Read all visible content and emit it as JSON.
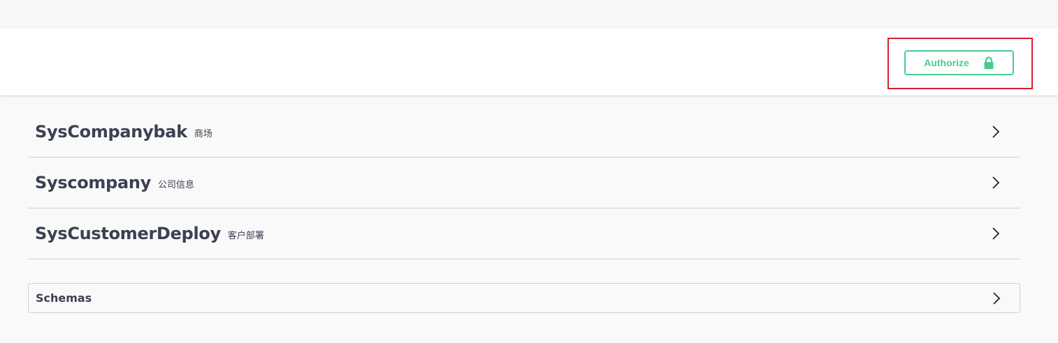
{
  "scheme_container": {
    "authorize_label": "Authorize",
    "icon": "lock-icon",
    "accent_color": "#49cc90",
    "highlight_color": "#d8202f"
  },
  "tags": [
    {
      "name": "SysCompanybak",
      "description": "商场",
      "icon": "chevron-right-icon"
    },
    {
      "name": "Syscompany",
      "description": "公司信息",
      "icon": "chevron-right-icon"
    },
    {
      "name": "SysCustomerDeploy",
      "description": "客户部署",
      "icon": "chevron-right-icon"
    }
  ],
  "schemas": {
    "title": "Schemas",
    "icon": "chevron-right-icon"
  }
}
